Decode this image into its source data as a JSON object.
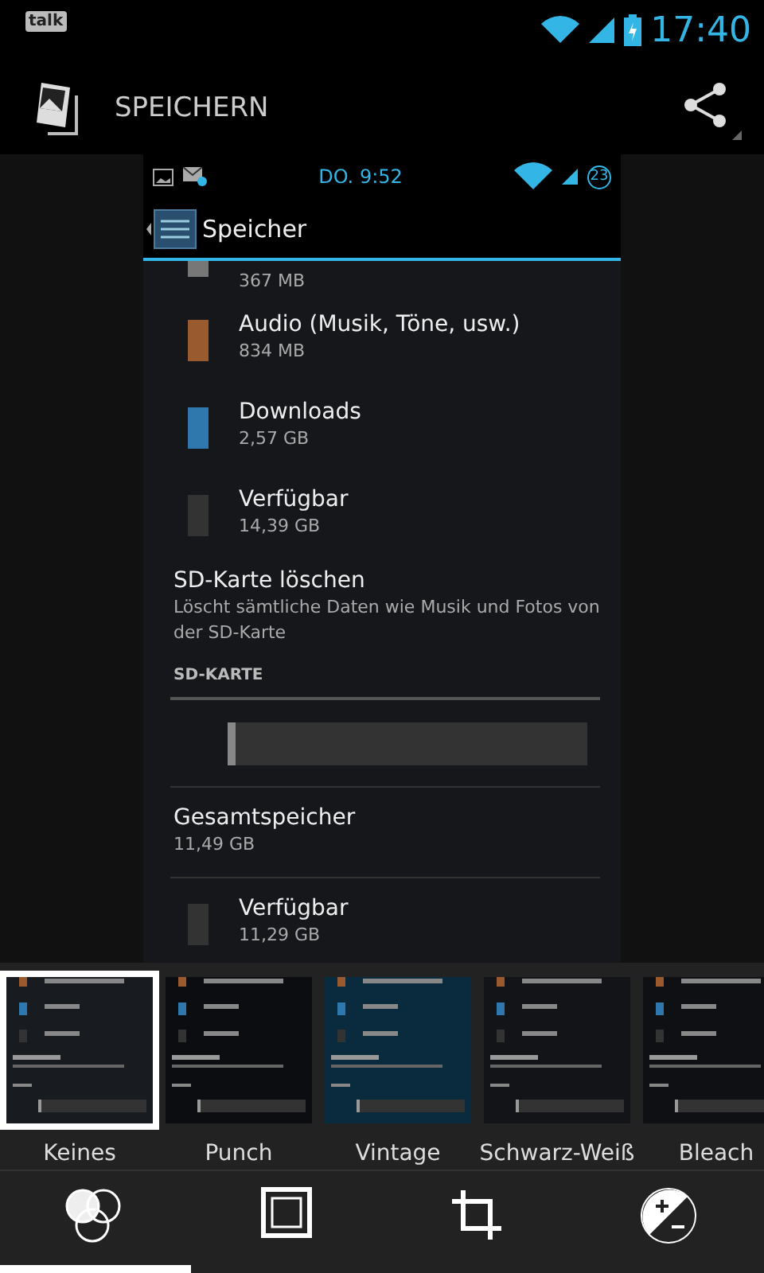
{
  "status_bar": {
    "notification": "talk",
    "time": "17:40"
  },
  "action_bar": {
    "title": "SPEICHERN"
  },
  "image": {
    "status_bar": {
      "time": "DO. 9:52",
      "badge": "23"
    },
    "title": "Speicher",
    "items": [
      {
        "kind": "partial",
        "size": "367 MB",
        "color": "#777777"
      },
      {
        "kind": "storage",
        "name": "Audio (Musik, Töne, usw.)",
        "size": "834 MB",
        "color": "#9a5a30"
      },
      {
        "kind": "storage",
        "name": "Downloads",
        "size": "2,57 GB",
        "color": "#2f78ad"
      },
      {
        "kind": "storage",
        "name": "Verfügbar",
        "size": "14,39 GB",
        "color": "#333333"
      },
      {
        "kind": "action",
        "name": "SD-Karte löschen",
        "description": "Löscht sämtliche Daten wie Musik und Fotos von der SD-Karte"
      },
      {
        "kind": "header",
        "name": "SD-KARTE"
      },
      {
        "kind": "bar",
        "level": 0.02
      },
      {
        "kind": "total",
        "name": "Gesamtspeicher",
        "size": "11,49 GB"
      },
      {
        "kind": "storage",
        "name": "Verfügbar",
        "size": "11,29 GB",
        "color": "#333333"
      }
    ]
  },
  "filters": [
    {
      "label": "Keines",
      "selected": true,
      "color": "#181b20"
    },
    {
      "label": "Punch",
      "selected": false,
      "color": "#0c0d10"
    },
    {
      "label": "Vintage",
      "selected": false,
      "color": "#0a2a3e"
    },
    {
      "label": "Schwarz-Weiß",
      "selected": false,
      "color": "#131417"
    },
    {
      "label": "Bleach",
      "selected": false,
      "color": "#0e1014"
    }
  ],
  "tools": [
    {
      "kind": "filters",
      "selected": true
    },
    {
      "kind": "border",
      "selected": false
    },
    {
      "kind": "crop",
      "selected": false
    },
    {
      "kind": "exposure",
      "selected": false
    }
  ]
}
